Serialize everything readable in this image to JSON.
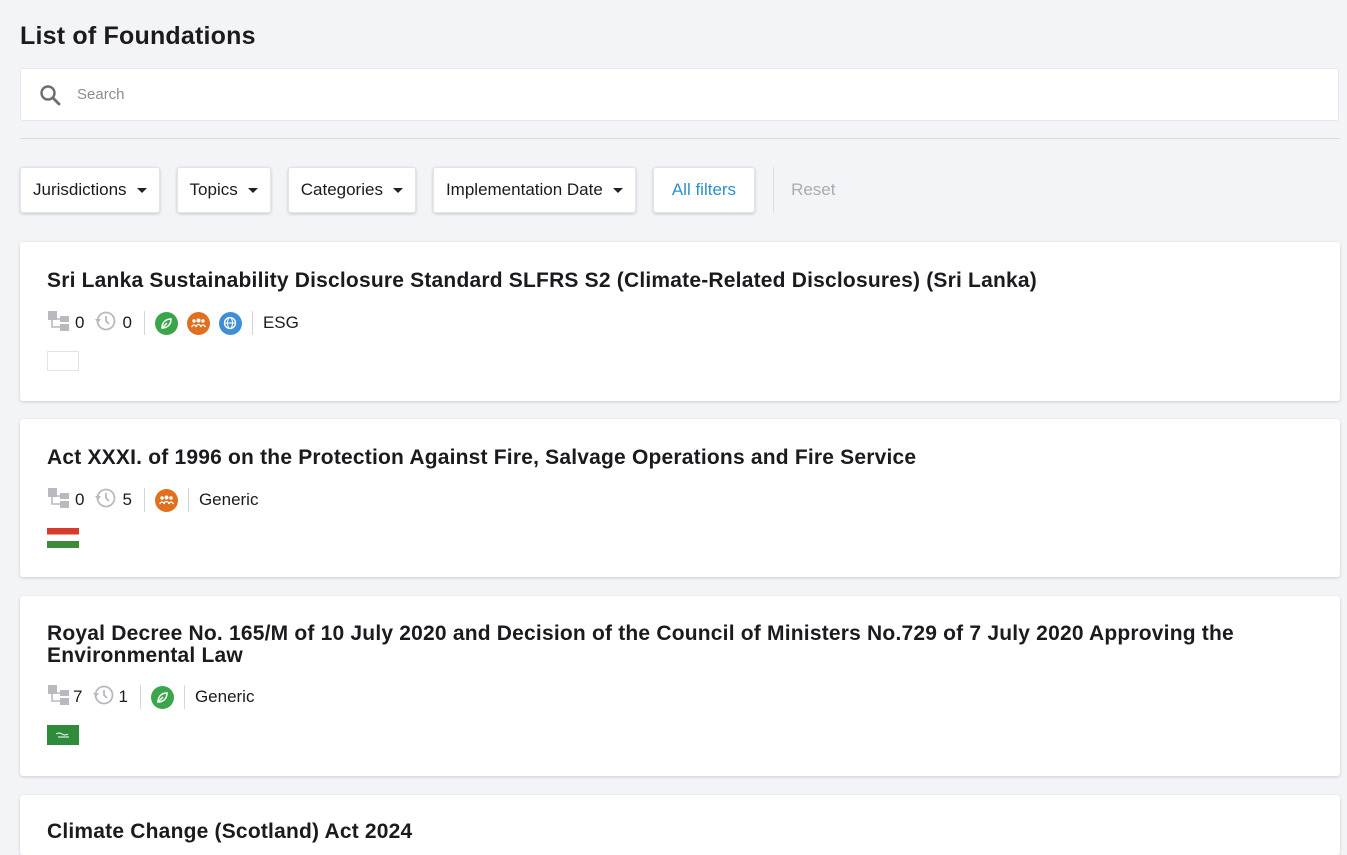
{
  "page": {
    "title": "List of Foundations"
  },
  "search": {
    "placeholder": "Search",
    "icon": "search-icon"
  },
  "filters": {
    "jurisdictions": "Jurisdictions",
    "topics": "Topics",
    "categories": "Categories",
    "implementation_date": "Implementation Date",
    "all_filters": "All filters",
    "reset": "Reset"
  },
  "colors": {
    "accent": "#2e8fc9",
    "green": "#3aa54a",
    "orange": "#e07020",
    "blue": "#3f8fd6"
  },
  "foundations": [
    {
      "title": "Sri Lanka Sustainability Disclosure Standard SLFRS S2 (Climate-Related Disclosures) (Sri Lanka)",
      "hierarchy_count": "0",
      "history_count": "0",
      "topic_icons": [
        "leaf-icon",
        "people-icon",
        "globe-icon"
      ],
      "category": "ESG",
      "flag": "blank-flag"
    },
    {
      "title": "Act XXXI. of 1996 on the Protection Against Fire, Salvage Operations and Fire Service",
      "hierarchy_count": "0",
      "history_count": "5",
      "topic_icons": [
        "people-icon"
      ],
      "category": "Generic",
      "flag": "hungary-flag"
    },
    {
      "title": "Royal Decree No. 165/M of 10 July 2020 and Decision of the Council of Ministers No.729 of 7 July 2020 Approving the Environmental Law",
      "hierarchy_count": "7",
      "history_count": "1",
      "topic_icons": [
        "leaf-icon"
      ],
      "category": "Generic",
      "flag": "saudi-arabia-flag"
    },
    {
      "title": "Climate Change (Scotland) Act 2024"
    }
  ]
}
